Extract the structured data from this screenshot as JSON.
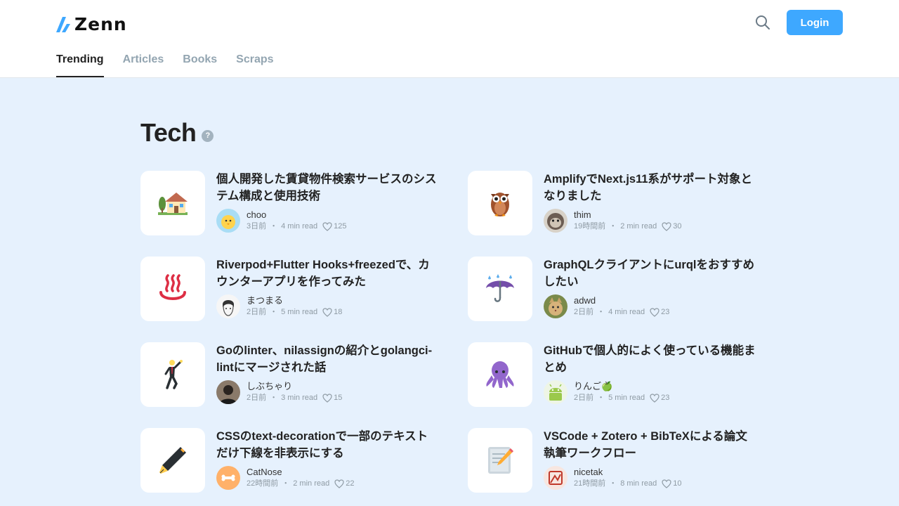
{
  "brand": {
    "name": "Zenn",
    "accent": "#3ea8ff"
  },
  "header": {
    "login_label": "Login",
    "search_icon": "search-icon"
  },
  "tabs": [
    {
      "label": "Trending",
      "active": true
    },
    {
      "label": "Articles",
      "active": false
    },
    {
      "label": "Books",
      "active": false
    },
    {
      "label": "Scraps",
      "active": false
    }
  ],
  "section": {
    "title": "Tech",
    "help_mark": "?"
  },
  "articles": [
    {
      "emoji": "house-with-garden",
      "title": "個人開発した賃貸物件検索サービスのシステム構成と使用技術",
      "author": "choo",
      "avatar": "yellow-chick",
      "time": "3日前",
      "read": "4 min read",
      "likes": "125"
    },
    {
      "emoji": "owl",
      "title": "AmplifyでNext.js11系がサポート対象となりました",
      "author": "thim",
      "avatar": "gray-monkey",
      "time": "19時間前",
      "read": "2 min read",
      "likes": "30"
    },
    {
      "emoji": "hot-springs",
      "title": "Riverpod+Flutter Hooks+freezedで、カウンターアプリを作ってみた",
      "author": "まつまる",
      "avatar": "sketch-face",
      "time": "2日前",
      "read": "5 min read",
      "likes": "18"
    },
    {
      "emoji": "umbrella-with-rain",
      "title": "GraphQLクライアントにurqlをおすすめしたい",
      "author": "adwd",
      "avatar": "cat-photo",
      "time": "2日前",
      "read": "4 min read",
      "likes": "23"
    },
    {
      "emoji": "man-dancing",
      "title": "Goのlinter、nilassignの紹介とgolangci-lintにマージされた話",
      "author": "しぶちゃり",
      "avatar": "person-photo",
      "time": "2日前",
      "read": "3 min read",
      "likes": "15"
    },
    {
      "emoji": "octopus",
      "title": "GitHubで個人的によく使っている機能まとめ",
      "author": "りんご🍏",
      "avatar": "android-robot",
      "time": "2日前",
      "read": "5 min read",
      "likes": "23"
    },
    {
      "emoji": "fountain-pen",
      "title": "CSSのtext-decorationで一部のテキストだけ下線を非表示にする",
      "author": "CatNose",
      "avatar": "orange-bone",
      "time": "22時間前",
      "read": "2 min read",
      "likes": "22"
    },
    {
      "emoji": "memo",
      "title": "VSCode + Zotero + BibTeXによる論文執筆ワークフロー",
      "author": "nicetak",
      "avatar": "red-logo",
      "time": "21時間前",
      "read": "8 min read",
      "likes": "10"
    }
  ]
}
